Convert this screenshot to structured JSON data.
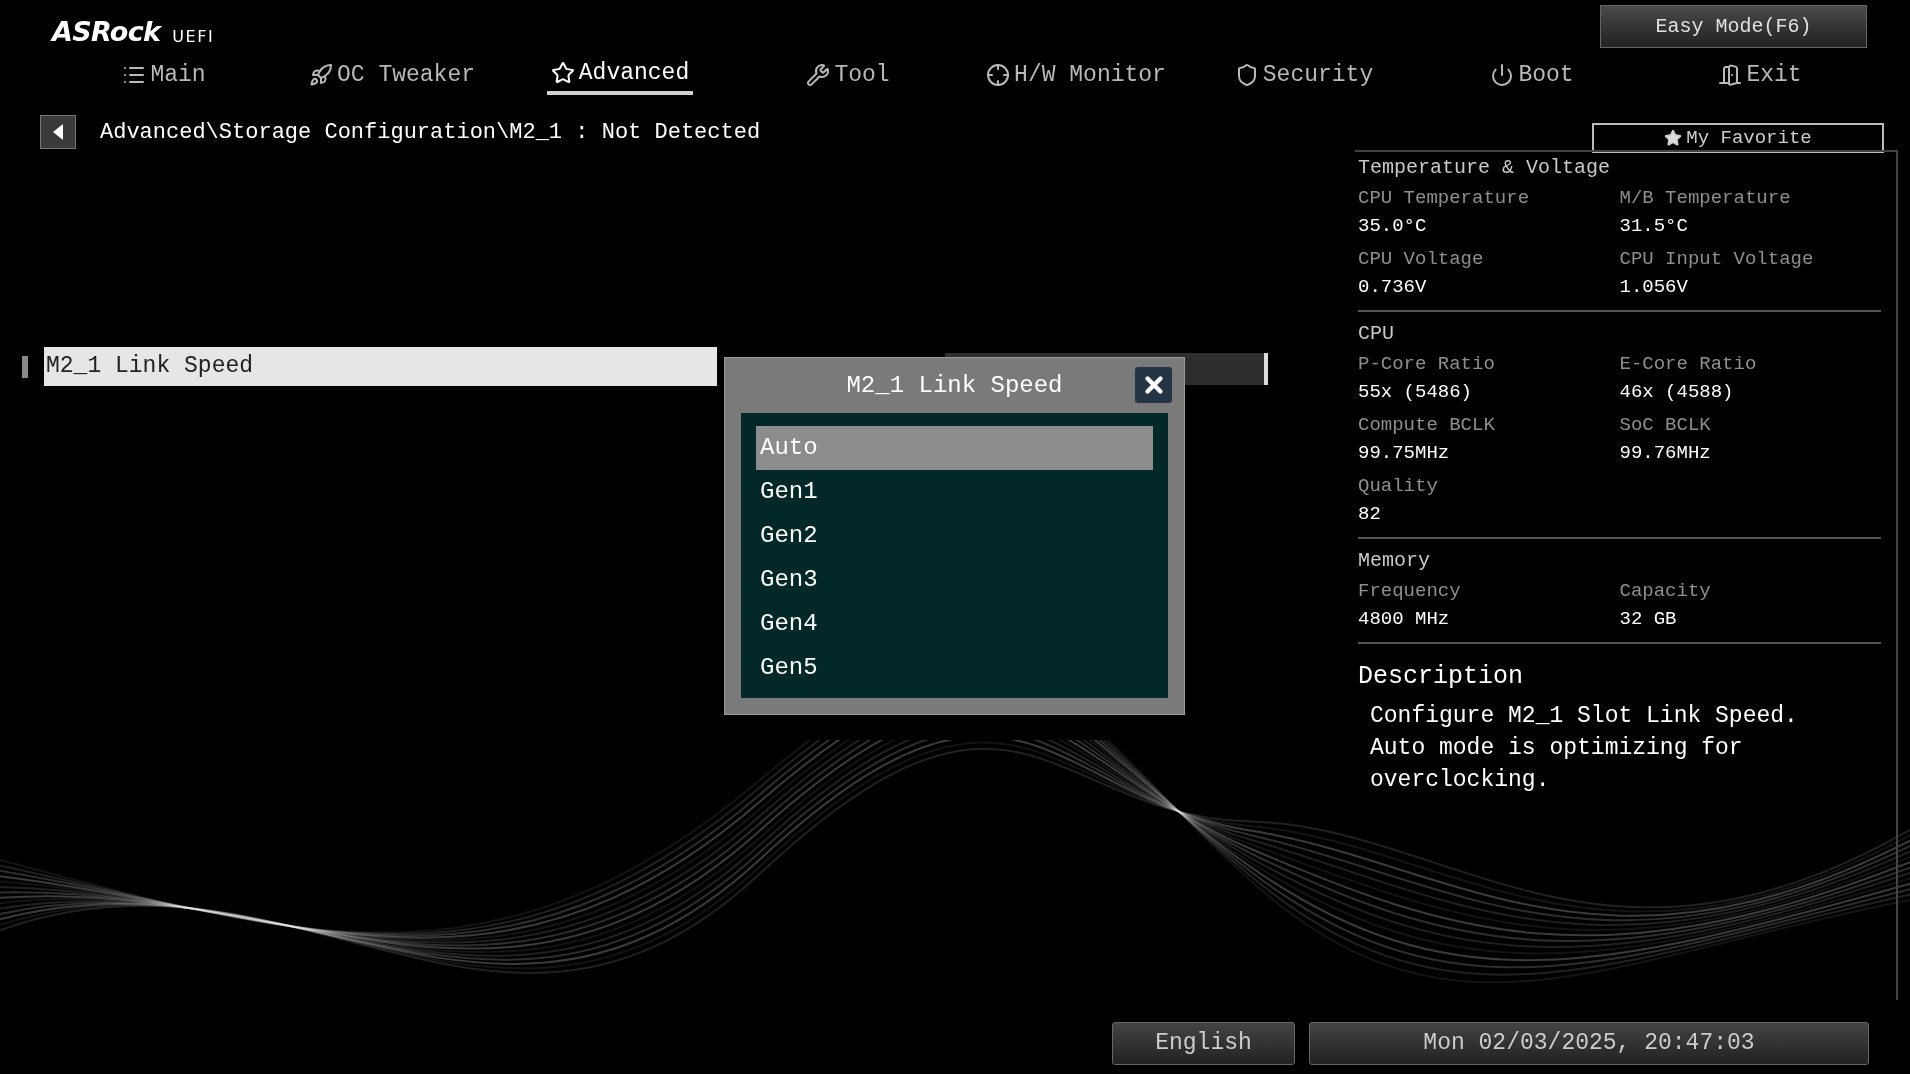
{
  "logo": {
    "brand": "ASRock",
    "suffix": "UEFI"
  },
  "easy_mode_button": "Easy Mode(F6)",
  "tabs": [
    {
      "label": "Main",
      "kind": "list",
      "selected": false
    },
    {
      "label": "OC Tweaker",
      "kind": "rocket",
      "selected": false
    },
    {
      "label": "Advanced",
      "kind": "star",
      "selected": true
    },
    {
      "label": "Tool",
      "kind": "wrench",
      "selected": false
    },
    {
      "label": "H/W Monitor",
      "kind": "crosshair",
      "selected": false
    },
    {
      "label": "Security",
      "kind": "shield",
      "selected": false
    },
    {
      "label": "Boot",
      "kind": "power",
      "selected": false
    },
    {
      "label": "Exit",
      "kind": "door",
      "selected": false
    }
  ],
  "my_favorite_button": "My Favorite",
  "breadcrumb": "Advanced\\Storage Configuration\\M2_1 : Not Detected",
  "setting": {
    "label": "M2_1 Link Speed"
  },
  "popup": {
    "title": "M2_1 Link Speed",
    "options": [
      {
        "label": "Auto",
        "selected": true
      },
      {
        "label": "Gen1",
        "selected": false
      },
      {
        "label": "Gen2",
        "selected": false
      },
      {
        "label": "Gen3",
        "selected": false
      },
      {
        "label": "Gen4",
        "selected": false
      },
      {
        "label": "Gen5",
        "selected": false
      }
    ]
  },
  "side_panel": {
    "sections": [
      {
        "title": "Temperature & Voltage",
        "items": [
          {
            "label": "CPU Temperature",
            "value": "35.0°C"
          },
          {
            "label": "M/B Temperature",
            "value": "31.5°C"
          },
          {
            "label": "CPU Voltage",
            "value": "0.736V"
          },
          {
            "label": "CPU Input Voltage",
            "value": "1.056V"
          }
        ]
      },
      {
        "title": "CPU",
        "items": [
          {
            "label": "P-Core Ratio",
            "value": "55x (5486)"
          },
          {
            "label": "E-Core Ratio",
            "value": "46x (4588)"
          },
          {
            "label": "Compute BCLK",
            "value": "99.75MHz"
          },
          {
            "label": "SoC BCLK",
            "value": "99.76MHz"
          },
          {
            "label": "Quality",
            "value": "82"
          }
        ]
      },
      {
        "title": "Memory",
        "items": [
          {
            "label": "Frequency",
            "value": "4800 MHz"
          },
          {
            "label": "Capacity",
            "value": "32 GB"
          }
        ]
      }
    ],
    "description": {
      "title": "Description",
      "text": "Configure M2_1 Slot Link Speed.\nAuto mode is optimizing for\noverclocking."
    }
  },
  "status_bar": {
    "language": "English",
    "datetime": "Mon 02/03/2025, 20:47:03"
  }
}
